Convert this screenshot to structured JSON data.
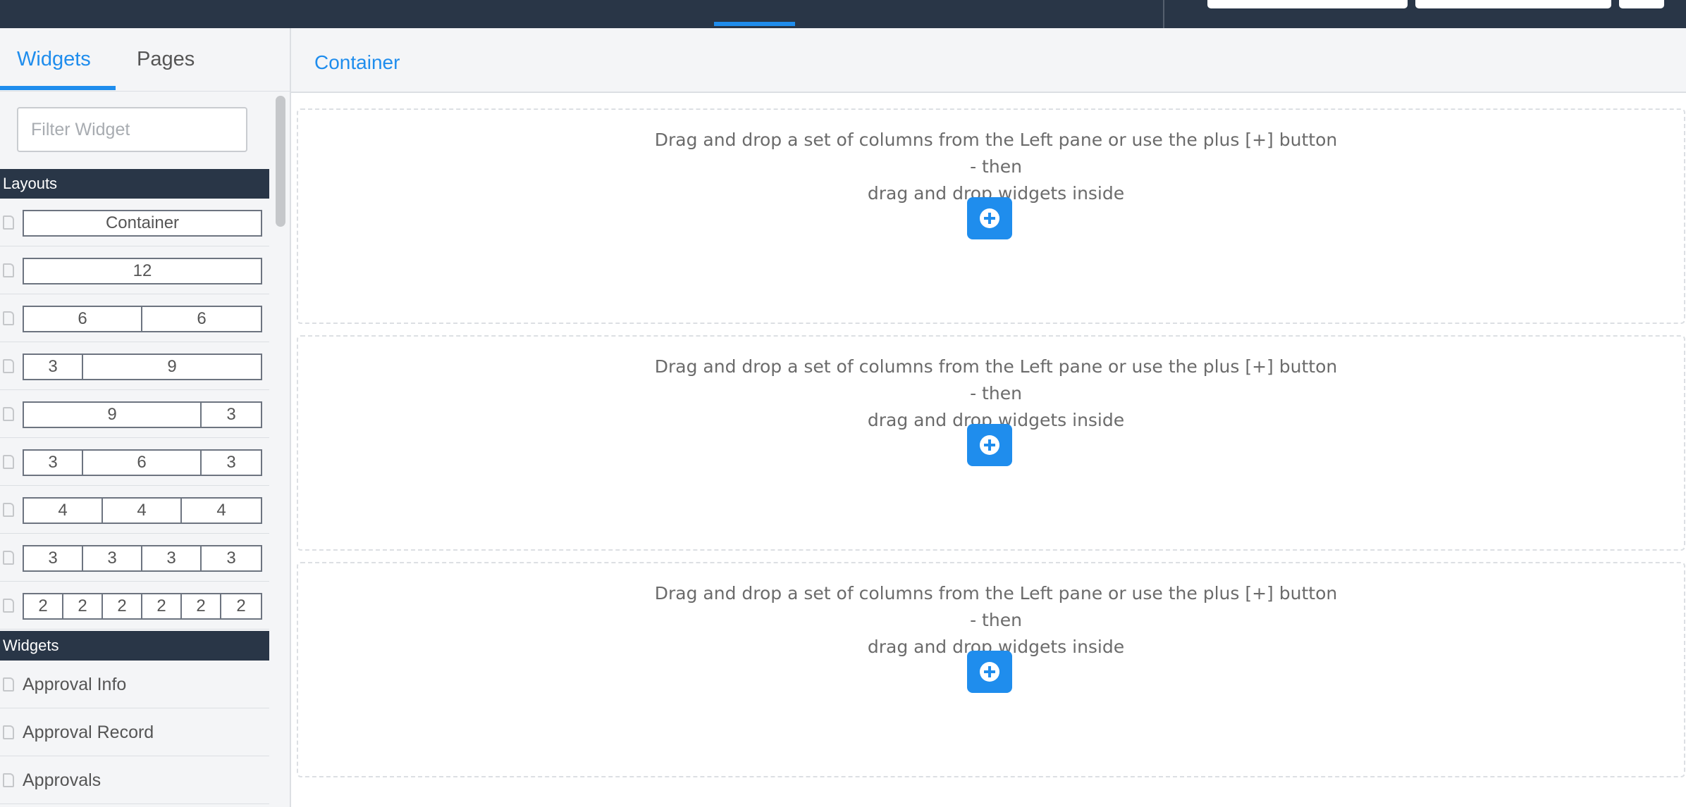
{
  "left_pane": {
    "tabs": [
      {
        "label": "Widgets",
        "active": true
      },
      {
        "label": "Pages",
        "active": false
      }
    ],
    "filter": {
      "placeholder": "Filter Widget",
      "value": ""
    },
    "sections": {
      "layouts": {
        "title": "Layouts",
        "rows": [
          {
            "name": "Container",
            "cols": [
              {
                "label": "Container",
                "span": 12
              }
            ]
          },
          {
            "name": "12",
            "cols": [
              {
                "label": "12",
                "span": 12
              }
            ]
          },
          {
            "name": "6-6",
            "cols": [
              {
                "label": "6",
                "span": 6
              },
              {
                "label": "6",
                "span": 6
              }
            ]
          },
          {
            "name": "3-9",
            "cols": [
              {
                "label": "3",
                "span": 3
              },
              {
                "label": "9",
                "span": 9
              }
            ]
          },
          {
            "name": "9-3",
            "cols": [
              {
                "label": "9",
                "span": 9
              },
              {
                "label": "3",
                "span": 3
              }
            ]
          },
          {
            "name": "3-6-3",
            "cols": [
              {
                "label": "3",
                "span": 3
              },
              {
                "label": "6",
                "span": 6
              },
              {
                "label": "3",
                "span": 3
              }
            ]
          },
          {
            "name": "4-4-4",
            "cols": [
              {
                "label": "4",
                "span": 4
              },
              {
                "label": "4",
                "span": 4
              },
              {
                "label": "4",
                "span": 4
              }
            ]
          },
          {
            "name": "3-3-3-3",
            "cols": [
              {
                "label": "3",
                "span": 3
              },
              {
                "label": "3",
                "span": 3
              },
              {
                "label": "3",
                "span": 3
              },
              {
                "label": "3",
                "span": 3
              }
            ]
          },
          {
            "name": "2-2-2-2-2-2",
            "cols": [
              {
                "label": "2",
                "span": 2
              },
              {
                "label": "2",
                "span": 2
              },
              {
                "label": "2",
                "span": 2
              },
              {
                "label": "2",
                "span": 2
              },
              {
                "label": "2",
                "span": 2
              },
              {
                "label": "2",
                "span": 2
              }
            ]
          }
        ]
      },
      "widgets": {
        "title": "Widgets",
        "items": [
          {
            "label": "Approval Info"
          },
          {
            "label": "Approval Record"
          },
          {
            "label": "Approvals"
          }
        ]
      }
    }
  },
  "main": {
    "breadcrumb": "Container",
    "dropzones": [
      {
        "line1": "Drag and drop a set of columns from the Left pane or use the plus [+] button - then",
        "line2": "drag and drop widgets inside"
      },
      {
        "line1": "Drag and drop a set of columns from the Left pane or use the plus [+] button - then",
        "line2": "drag and drop widgets inside"
      },
      {
        "line1": "Drag and drop a set of columns from the Left pane or use the plus [+] button - then",
        "line2": "drag and drop widgets inside"
      }
    ],
    "add_icon": "plus-circle-icon"
  },
  "colors": {
    "navbar": "#293647",
    "accent": "#1f8ded",
    "panel_bg": "#f4f5f7"
  }
}
